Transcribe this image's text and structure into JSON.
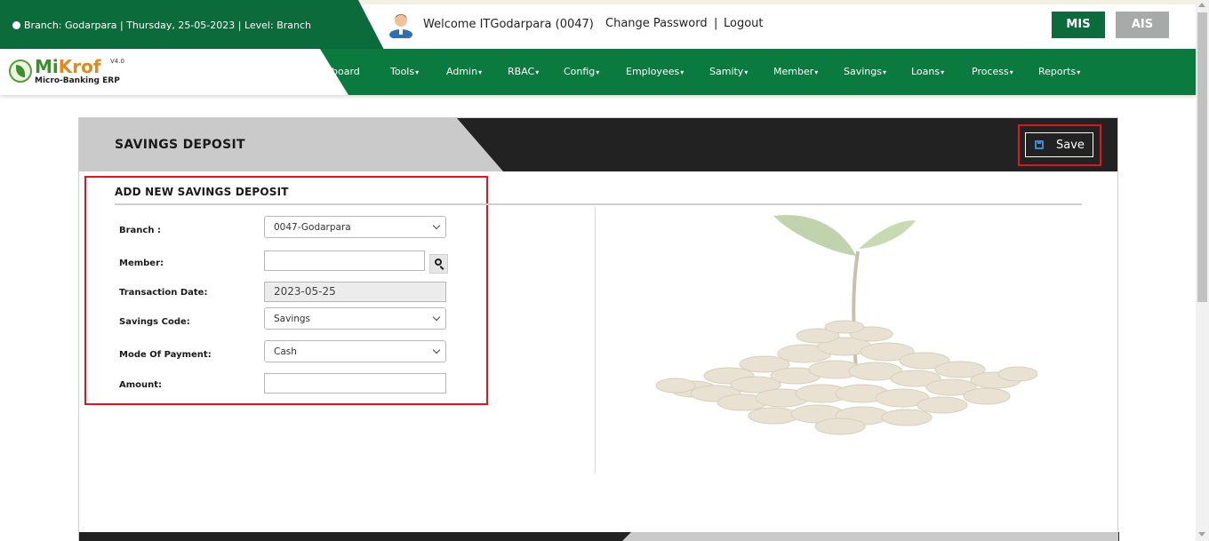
{
  "header": {
    "branch_info": "Branch: Godarpara | Thursday, 25-05-2023 | Level: Branch",
    "welcome": "Welcome ITGodarpara (0047)",
    "change_password": "Change Password",
    "separator": "|",
    "logout": "Logout",
    "mis_button": "MIS",
    "ais_button": "AIS"
  },
  "logo": {
    "name_part1": "Mi",
    "name_part2": "Krof",
    "subtitle": "Micro-Banking ERP",
    "version": "V4.0"
  },
  "nav": {
    "items": [
      {
        "label": "board",
        "has_caret": false
      },
      {
        "label": "Tools",
        "has_caret": true
      },
      {
        "label": "Admin",
        "has_caret": true
      },
      {
        "label": "RBAC",
        "has_caret": true
      },
      {
        "label": "Config",
        "has_caret": true
      },
      {
        "label": "Employees",
        "has_caret": true
      },
      {
        "label": "Samity",
        "has_caret": true
      },
      {
        "label": "Member",
        "has_caret": true
      },
      {
        "label": "Savings",
        "has_caret": true
      },
      {
        "label": "Loans",
        "has_caret": true
      },
      {
        "label": "Process",
        "has_caret": true
      },
      {
        "label": "Reports",
        "has_caret": true
      }
    ]
  },
  "panel": {
    "title": "SAVINGS DEPOSIT",
    "save_label": "Save"
  },
  "form": {
    "title": "ADD NEW SAVINGS DEPOSIT",
    "branch": {
      "label": "Branch :",
      "value": "0047-Godarpara"
    },
    "member": {
      "label": "Member:",
      "value": ""
    },
    "transaction_date": {
      "label": "Transaction Date:",
      "value": "2023-05-25"
    },
    "savings_code": {
      "label": "Savings Code:",
      "value": "Savings"
    },
    "mode_of_payment": {
      "label": "Mode Of Payment:",
      "value": "Cash"
    },
    "amount": {
      "label": "Amount:",
      "value": ""
    }
  },
  "colors": {
    "primary_green": "#0b7a3e",
    "dark_header": "#222222",
    "highlight_red": "#e3141b",
    "ais_gray": "#a6aaa8"
  },
  "icons": {
    "globe": "globe-icon",
    "user_avatar": "user-avatar-icon",
    "save": "floppy-disk-icon",
    "search": "search-icon",
    "dropdown": "chevron-down-icon"
  }
}
